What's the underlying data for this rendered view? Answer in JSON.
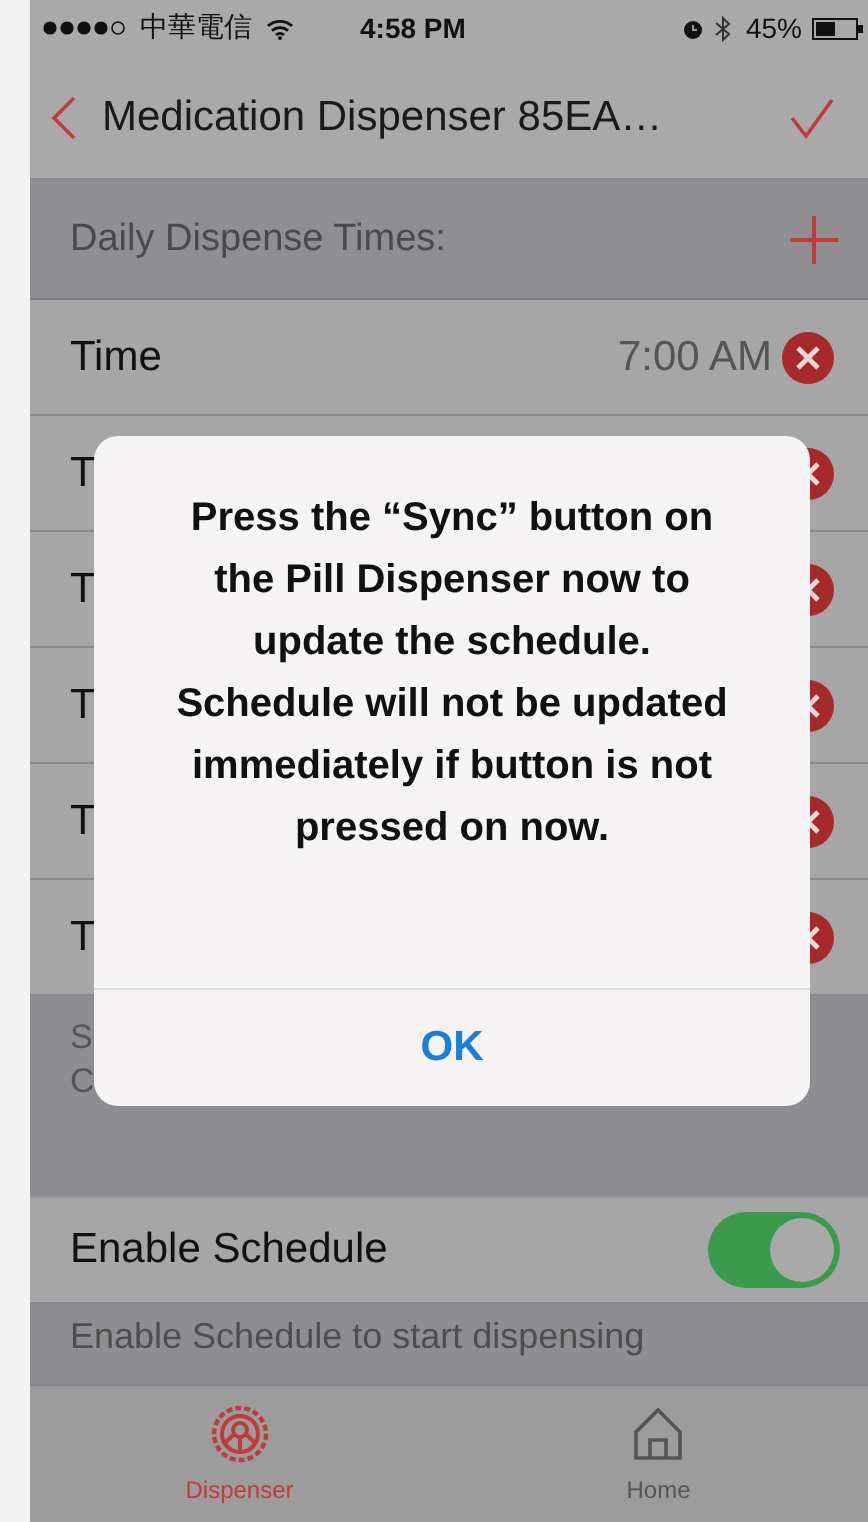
{
  "status_bar": {
    "carrier": "中華電信",
    "time": "4:58 PM",
    "battery": "45%"
  },
  "nav": {
    "title": "Medication Dispenser 85EA…"
  },
  "section": {
    "title": "Daily Dispense Times:"
  },
  "times": [
    {
      "label": "Time",
      "value": "7:00 AM"
    },
    {
      "label": "T"
    },
    {
      "label": "T"
    },
    {
      "label": "T"
    },
    {
      "label": "T"
    },
    {
      "label": "T"
    }
  ],
  "note_lines": [
    "S",
    "C"
  ],
  "enable": {
    "label": "Enable Schedule",
    "on": true
  },
  "description": "Enable Schedule to start dispensing",
  "tabs": [
    {
      "label": "Dispenser",
      "kind": "dispenser",
      "selected": true
    },
    {
      "label": "Home",
      "kind": "home",
      "selected": false
    }
  ],
  "alert": {
    "message": "Press the “Sync” button on the Pill Dispenser now to update the schedule. Schedule will not be updated immediately if button is not pressed on now.",
    "button": "OK"
  }
}
